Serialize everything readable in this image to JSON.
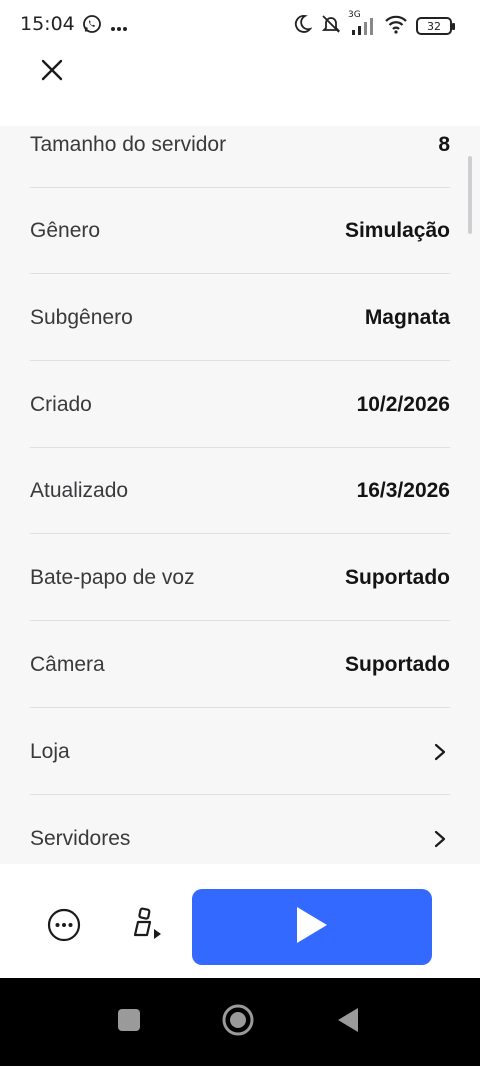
{
  "status_bar": {
    "time": "15:04",
    "network": "3G",
    "battery": "32"
  },
  "details": [
    {
      "label": "Tamanho do servidor",
      "value": "8"
    },
    {
      "label": "Gênero",
      "value": "Simulação"
    },
    {
      "label": "Subgênero",
      "value": "Magnata"
    },
    {
      "label": "Criado",
      "value": "10/2/2026"
    },
    {
      "label": "Atualizado",
      "value": "16/3/2026"
    },
    {
      "label": "Bate-papo de voz",
      "value": "Suportado"
    },
    {
      "label": "Câmera",
      "value": "Suportado"
    }
  ],
  "links": [
    {
      "label": "Loja"
    },
    {
      "label": "Servidores"
    }
  ],
  "colors": {
    "accent": "#3369ff",
    "content_bg": "#f7f7f8",
    "divider": "#e0e0e3"
  },
  "icons": {
    "close": "close-icon",
    "more": "more-options-icon",
    "avatar": "avatar-play-icon",
    "play": "play-icon"
  }
}
